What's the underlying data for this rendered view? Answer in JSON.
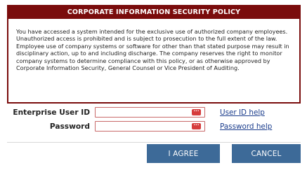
{
  "policy": {
    "title": "CORPORATE INFORMATION SECURITY POLICY",
    "text": "You have accessed a system intended for the exclusive use of authorized company employees.  Unauthorized access is prohibited and is subject to prosecution to the full extent of the law.  Employee use of company systems or software for other than that stated purpose may result in disciplinary action, up to and including discharge.  The company reserves the right to monitor company systems to determine compliance with this policy, or as otherwise approved by Corporate Information Security, General Counsel or Vice President of Auditing."
  },
  "form": {
    "user_id": {
      "label": "Enterprise User ID",
      "value": "",
      "help_link": "User ID help",
      "icon": "password-manager-dots-icon"
    },
    "password": {
      "label": "Password",
      "value": "",
      "help_link": "Password help",
      "icon": "password-manager-dots-icon"
    }
  },
  "buttons": {
    "agree": "I AGREE",
    "cancel": "CANCEL"
  },
  "colors": {
    "policy_border": "#7a0c0c",
    "button": "#3d6a98",
    "link": "#1a3c8c"
  }
}
